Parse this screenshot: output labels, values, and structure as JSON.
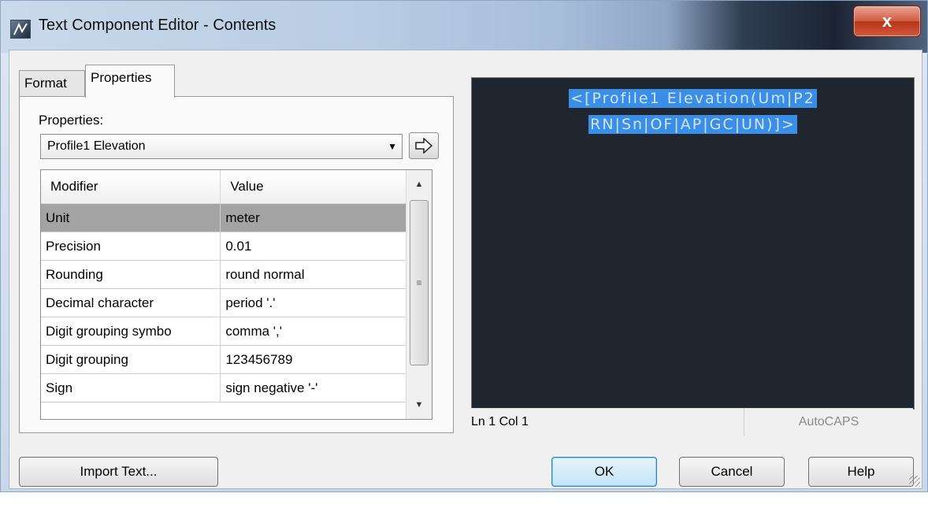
{
  "window": {
    "title": "Text Component Editor - Contents",
    "close_label": "x"
  },
  "tabs": [
    {
      "label": "Format"
    },
    {
      "label": "Properties"
    }
  ],
  "properties": {
    "label": "Properties:",
    "selected": "Profile1 Elevation"
  },
  "table": {
    "columns": [
      "Modifier",
      "Value"
    ],
    "rows": [
      {
        "modifier": "Unit",
        "value": "meter"
      },
      {
        "modifier": "Precision",
        "value": "0.01"
      },
      {
        "modifier": "Rounding",
        "value": "round normal"
      },
      {
        "modifier": "Decimal character",
        "value": "period '.'"
      },
      {
        "modifier": "Digit grouping symbo",
        "value": "comma ','"
      },
      {
        "modifier": "Digit grouping",
        "value": "123456789"
      },
      {
        "modifier": "Sign",
        "value": "sign negative '-'"
      }
    ]
  },
  "preview": {
    "line1": "<[Profile1 Elevation(Um|P2",
    "line2": "RN|Sn|OF|AP|GC|UN)]>"
  },
  "status": {
    "position": "Ln 1 Col 1",
    "caps": "AutoCAPS"
  },
  "buttons": {
    "import": "Import Text...",
    "ok": "OK",
    "cancel": "Cancel",
    "help": "Help"
  }
}
